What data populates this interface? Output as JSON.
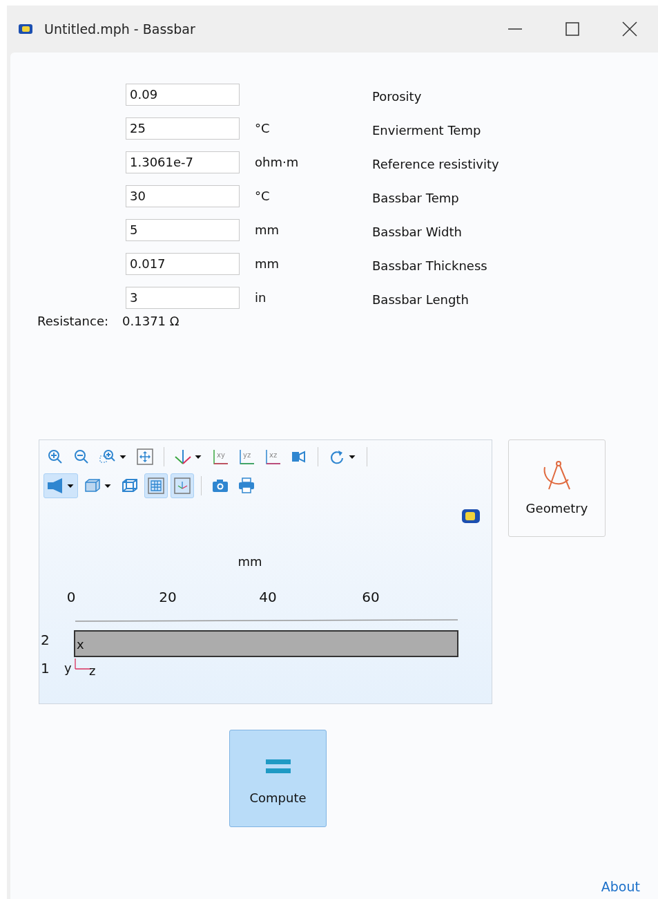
{
  "window": {
    "title": "Untitled.mph - Bassbar"
  },
  "inputs": [
    {
      "value": "0.09",
      "label": "Porosity"
    },
    {
      "value": "25",
      "unit": "°C",
      "label": "Envierment Temp"
    },
    {
      "value": "1.3061e-7",
      "unit": "ohm·m",
      "label": "Reference resistivity"
    },
    {
      "value": "30",
      "unit": "°C",
      "label": "Bassbar Temp"
    },
    {
      "value": "5",
      "unit": "mm",
      "label": "Bassbar Width"
    },
    {
      "value": "0.017",
      "unit": "mm",
      "label": "Bassbar Thickness"
    },
    {
      "value": "3",
      "unit": "in",
      "label": "Bassbar Length"
    }
  ],
  "result": {
    "label": "Resistance:",
    "value": "0.1371 Ω"
  },
  "toolbar": [
    [
      {
        "kind": "zoom-in",
        "selected": false,
        "dropdown": false
      },
      {
        "kind": "zoom-out",
        "selected": false,
        "dropdown": false
      },
      {
        "kind": "zoom-box",
        "selected": false,
        "dropdown": true
      },
      {
        "kind": "zoom-extents",
        "selected": false,
        "dropdown": false
      },
      {
        "kind": "sep"
      },
      {
        "kind": "axes",
        "selected": false,
        "dropdown": true
      },
      {
        "kind": "xy",
        "selected": false,
        "dropdown": false
      },
      {
        "kind": "yz",
        "selected": false,
        "dropdown": false
      },
      {
        "kind": "xz",
        "selected": false,
        "dropdown": false
      },
      {
        "kind": "camera-view",
        "selected": false,
        "dropdown": false
      },
      {
        "kind": "sep"
      },
      {
        "kind": "reset",
        "selected": false,
        "dropdown": true
      },
      {
        "kind": "sep"
      }
    ],
    [
      {
        "kind": "light",
        "selected": true,
        "dropdown": true
      },
      {
        "kind": "box",
        "selected": false,
        "dropdown": true
      },
      {
        "kind": "wireframe",
        "selected": false,
        "dropdown": false
      },
      {
        "kind": "grid",
        "selected": true,
        "dropdown": false
      },
      {
        "kind": "axis-frame",
        "selected": true,
        "dropdown": false
      },
      {
        "kind": "sep"
      },
      {
        "kind": "photo",
        "selected": false,
        "dropdown": false
      },
      {
        "kind": "print",
        "selected": false,
        "dropdown": false
      }
    ]
  ],
  "graphics": {
    "unit": "mm",
    "x_labels": [
      "0",
      "20",
      "40",
      "60"
    ],
    "y_labels": [
      "2",
      "1"
    ],
    "triad": [
      "x",
      "y",
      "z"
    ]
  },
  "buttons": [
    {
      "kind": "geometry",
      "label": "Geometry"
    },
    {
      "kind": "compute",
      "label": "Compute"
    }
  ],
  "footer_link": "About"
}
